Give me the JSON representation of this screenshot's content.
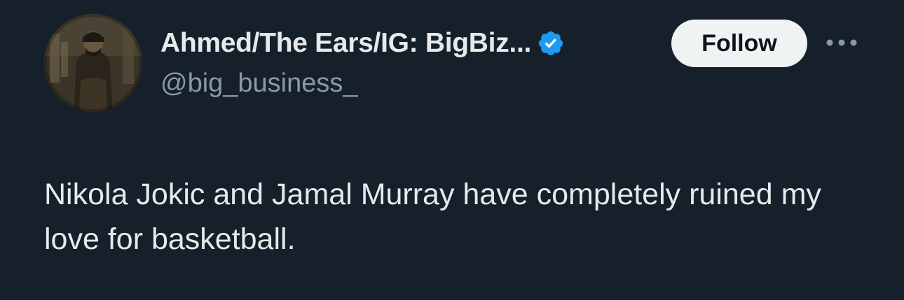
{
  "author": {
    "display_name": "Ahmed/The Ears/IG: BigBiz...",
    "handle": "@big_business_",
    "avatar_icon": "profile-photo",
    "verified_icon": "verified-badge-icon"
  },
  "actions": {
    "follow_label": "Follow",
    "more_icon": "more-options-icon"
  },
  "tweet": {
    "text": "Nikola Jokic and Jamal Murray have completely ruined my love for basketball."
  },
  "colors": {
    "background": "#15202b",
    "primary_text": "#e7e9ea",
    "secondary_text": "#8b98a5",
    "verified_blue": "#1d9bf0",
    "follow_bg": "#eff3f4"
  }
}
